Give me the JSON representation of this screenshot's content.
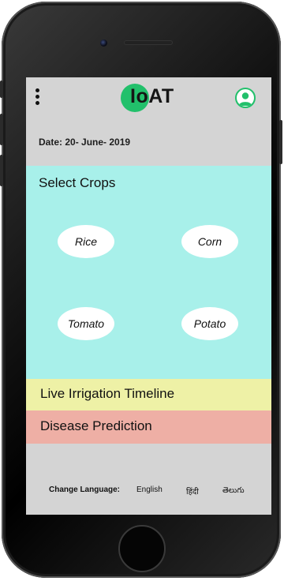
{
  "app": {
    "logo_text": "IoAT",
    "brand_color": "#22c06b"
  },
  "header": {
    "menu_icon": "more-vertical-icon",
    "profile_icon": "user-avatar-icon"
  },
  "date_label": "Date: 20- June- 2019",
  "crops": {
    "title": "Select Crops",
    "background": "#a8f0ea",
    "items": [
      {
        "label": "Rice"
      },
      {
        "label": "Corn"
      },
      {
        "label": "Tomato"
      },
      {
        "label": "Potato"
      }
    ]
  },
  "sections": {
    "irrigation_label": "Live Irrigation Timeline",
    "irrigation_color": "#eef1a6",
    "disease_label": "Disease Prediction",
    "disease_color": "#eeafa5"
  },
  "language": {
    "label": "Change Language:",
    "options": [
      "English",
      "हिंदी",
      "తెలుగు"
    ]
  }
}
